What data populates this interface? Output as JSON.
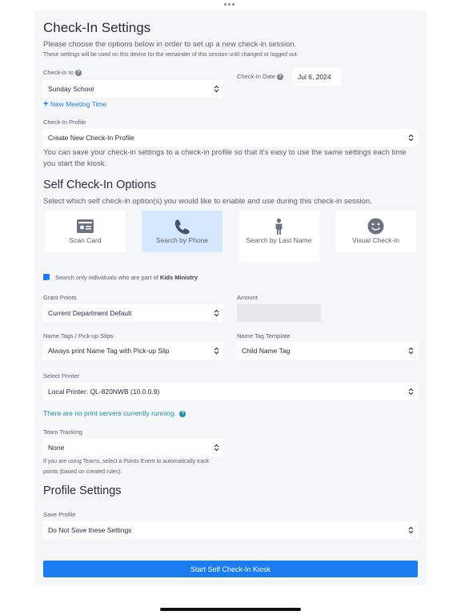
{
  "header": {
    "title": "Check-In Settings",
    "intro": "Please choose the options below in order to set up a new check-in session.",
    "intro_note": "These settings will be used on this device for the remainder of this session until changed or logged out."
  },
  "checkin_to": {
    "label": "Check-in to",
    "value": "Sunday School"
  },
  "checkin_date": {
    "label": "Check-In Date",
    "value": "Jul 6, 2024"
  },
  "new_meeting_link": "New Meeting Time",
  "checkin_profile": {
    "label": "Check-In Profile",
    "value": "Create New Check-In Profile",
    "help": "You can save your check-in settings to a check-in profile so that it's easy to use the same settings each time you start the kiosk."
  },
  "self_checkin": {
    "title": "Self Check-In Options",
    "intro": "Select which self check-in option(s) you would like to enable and use during this check-in session.",
    "options": [
      {
        "label": "Scan Card",
        "icon": "id-card-icon",
        "selected": false
      },
      {
        "label": "Search by Phone",
        "icon": "phone-icon",
        "selected": true
      },
      {
        "label": "Search by Last Name",
        "icon": "person-icon",
        "selected": false
      },
      {
        "label": "Visual Check-in",
        "icon": "smiley-face-icon",
        "selected": false
      }
    ]
  },
  "search_only": {
    "prefix": "Search only individuals who are part of",
    "group": "Kids Ministry",
    "checked": true
  },
  "grant_points": {
    "label": "Grant Points",
    "value": "Current Department Default"
  },
  "amount": {
    "label": "Amount",
    "value": ""
  },
  "name_tags": {
    "label": "Name Tags / Pick-up Slips",
    "value": "Always print Name Tag with Pick-up Slip"
  },
  "name_tag_template": {
    "label": "Name Tag Template",
    "value": "Child Name Tag"
  },
  "printer": {
    "label": "Select Printer",
    "value": "Local Printer: QL-820NWB (10.0.0.9)"
  },
  "print_server_notice": "There are no print servers currently running.",
  "team_tracking": {
    "label": "Team Tracking",
    "value": "None",
    "help_line1": "If you are using Teams, select a Points Event to automatically track",
    "help_line2": "points (based on created rules)."
  },
  "profile_settings": {
    "title": "Profile Settings",
    "label": "Save Profile",
    "value": "Do Not Save these Settings"
  },
  "start_button": "Start Self Check-In Kiosk",
  "colors": {
    "accent": "#1a7cf0",
    "selected_tile": "#d5e8fd",
    "teal_notice": "#1d8fa5",
    "panel": "#f5f6f8"
  }
}
